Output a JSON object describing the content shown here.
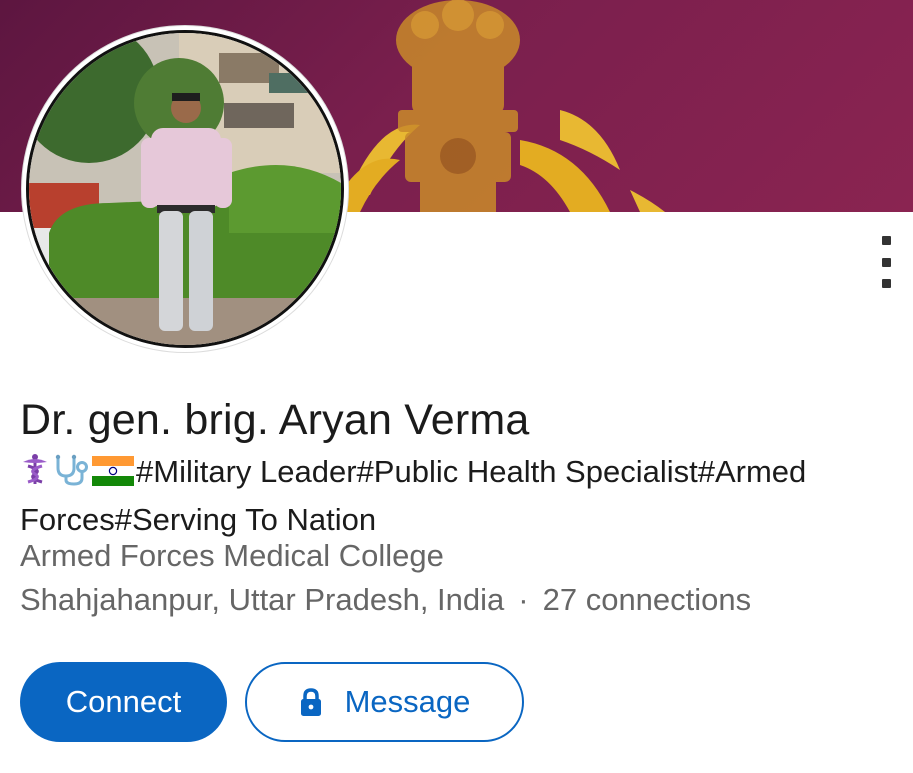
{
  "profile": {
    "name": "Dr. gen. brig. Aryan Verma",
    "headline_emojis": [
      "caduceus-icon",
      "stethoscope-icon",
      "india-flag-icon"
    ],
    "headline_text": "#Military Leader#Public Health Specialist#Armed Forces#Serving To Nation",
    "school": "Armed Forces Medical College",
    "location": "Shahjahanpur, Uttar Pradesh, India",
    "separator": "·",
    "connections": "27 connections"
  },
  "actions": {
    "connect_label": "Connect",
    "message_label": "Message"
  },
  "colors": {
    "brand_blue": "#0a66c2",
    "banner_maroon": "#7a1f4d",
    "emblem_gold": "#e8b832",
    "secondary_text": "#666666"
  },
  "icons": {
    "more": "more-vertical-icon",
    "lock": "lock-icon"
  }
}
